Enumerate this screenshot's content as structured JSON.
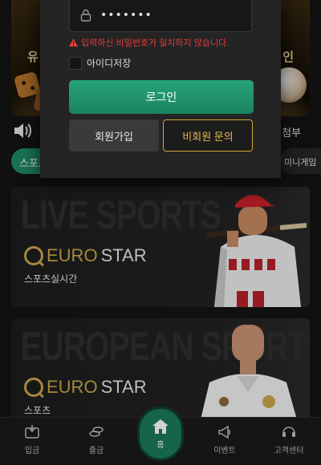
{
  "background": {
    "promo_left_text": "유",
    "promo_right_text": "인",
    "notice_right_text": "첨부",
    "categories": {
      "active": "스포츠",
      "right": "미니게임"
    },
    "cards": [
      {
        "headline": "LIVE SPORTS",
        "brand_euro": "EURO",
        "brand_star": "STAR",
        "subtitle": "스포츠실시간"
      },
      {
        "headline": "EUROPEAN SPORTS",
        "brand_euro": "EURO",
        "brand_star": "STAR",
        "subtitle": "스포츠"
      }
    ]
  },
  "login_modal": {
    "password_value": "•••••••",
    "error_message": "입력하신 비밀번호가 일치하지 않습니다.",
    "remember_id_label": "아이디저장",
    "remember_id_checked": false,
    "login_button": "로그인",
    "join_button": "회원가입",
    "guest_inquiry_button": "비회원 문의"
  },
  "bottom_nav": {
    "items": [
      {
        "label": "입금",
        "icon": "deposit-icon"
      },
      {
        "label": "출금",
        "icon": "withdraw-icon"
      },
      {
        "label": "홈",
        "icon": "home-icon"
      },
      {
        "label": "이벤트",
        "icon": "megaphone-icon"
      },
      {
        "label": "고객센터",
        "icon": "support-icon"
      }
    ]
  },
  "colors": {
    "accent_green": "#1f8a6a",
    "gold": "#c9a64a",
    "error_red": "#e33b3b",
    "modal_bg": "#242424"
  }
}
